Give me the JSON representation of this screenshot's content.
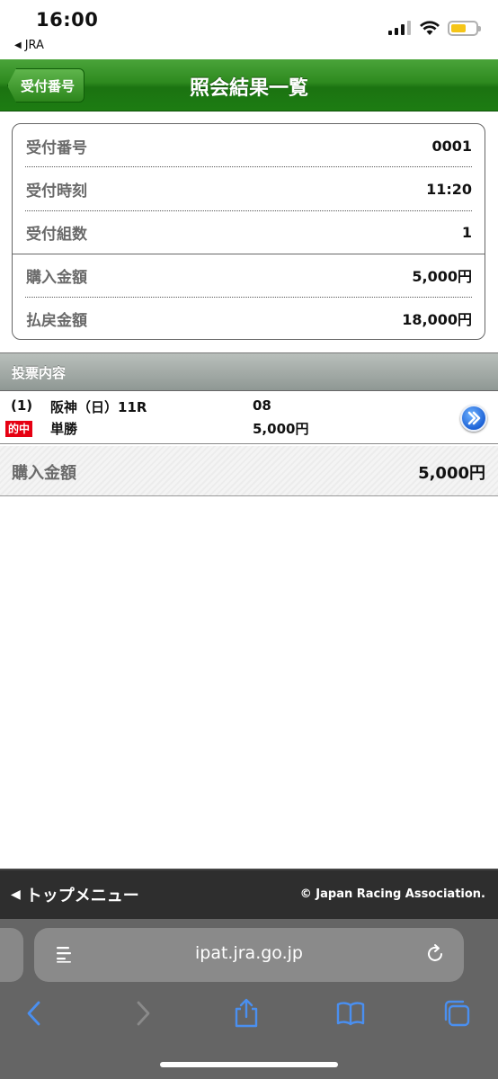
{
  "status_bar": {
    "time": "16:00",
    "back_app": "JRA"
  },
  "header": {
    "back_label": "受付番号",
    "title": "照会結果一覧"
  },
  "info": {
    "rows": [
      {
        "label": "受付番号",
        "value": "0001"
      },
      {
        "label": "受付時刻",
        "value": "11:20"
      },
      {
        "label": "受付組数",
        "value": "1"
      },
      {
        "label": "購入金額",
        "value": "5,000円"
      },
      {
        "label": "払戻金額",
        "value": "18,000円"
      }
    ]
  },
  "section": {
    "title": "投票内容"
  },
  "bet": {
    "number": "(1)",
    "race": "阪神（日）11R",
    "horse": "08",
    "badge": "的中",
    "bet_type": "単勝",
    "amount": "5,000円"
  },
  "total": {
    "label": "購入金額",
    "value": "5,000円"
  },
  "footer": {
    "top_menu": "トップメニュー",
    "copyright": "© Japan Racing Association."
  },
  "browser": {
    "url": "ipat.jra.go.jp"
  },
  "colors": {
    "header_green": "#1d7c12",
    "hit_red": "#e60012",
    "section_gray": "#8f9894",
    "link_blue": "#4a8ff0"
  }
}
